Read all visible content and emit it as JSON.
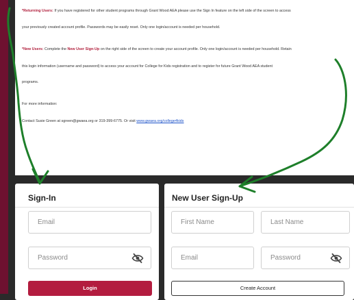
{
  "info": {
    "returning_label": "*Returning Users:",
    "returning_text": " If you have registered for other student programs through Grant Wood AEA please use the Sign In feature on the left side of the screen to access",
    "returning_text2": "your previously created account profile.  Passwords may be easily reset. Only one login/account is needed per household.",
    "new_label": "*New Users:",
    "new_text_a": " Complete the ",
    "new_link_label": "New User Sign-Up",
    "new_text_b": " on the right side of the screen to create your account profile. Only one login/account is needed per household. Retain",
    "new_text2": "this login information (username and password) to access your account for College for Kids registration and to register for future Grant Wood AEA student",
    "new_text3": "programs.",
    "more_info": "For more information:",
    "contact_text": "Contact Susie Green at sgreen@gwaea.org or 319-399-6775. Or visit ",
    "contact_link": "www.gwaea.org/college4kids"
  },
  "signin": {
    "title": "Sign-In",
    "email_placeholder": "Email",
    "password_placeholder": "Password",
    "login_label": "Login"
  },
  "signup": {
    "title": "New User Sign-Up",
    "first_name_placeholder": "First Name",
    "last_name_placeholder": "Last Name",
    "email_placeholder": "Email",
    "password_placeholder": "Password",
    "create_label": "Create Account"
  },
  "colors": {
    "brand": "#b31c3f",
    "annotation": "#1e7f2a",
    "sidebar": "#6e1130"
  },
  "icons": [
    "eye-slash-icon"
  ]
}
